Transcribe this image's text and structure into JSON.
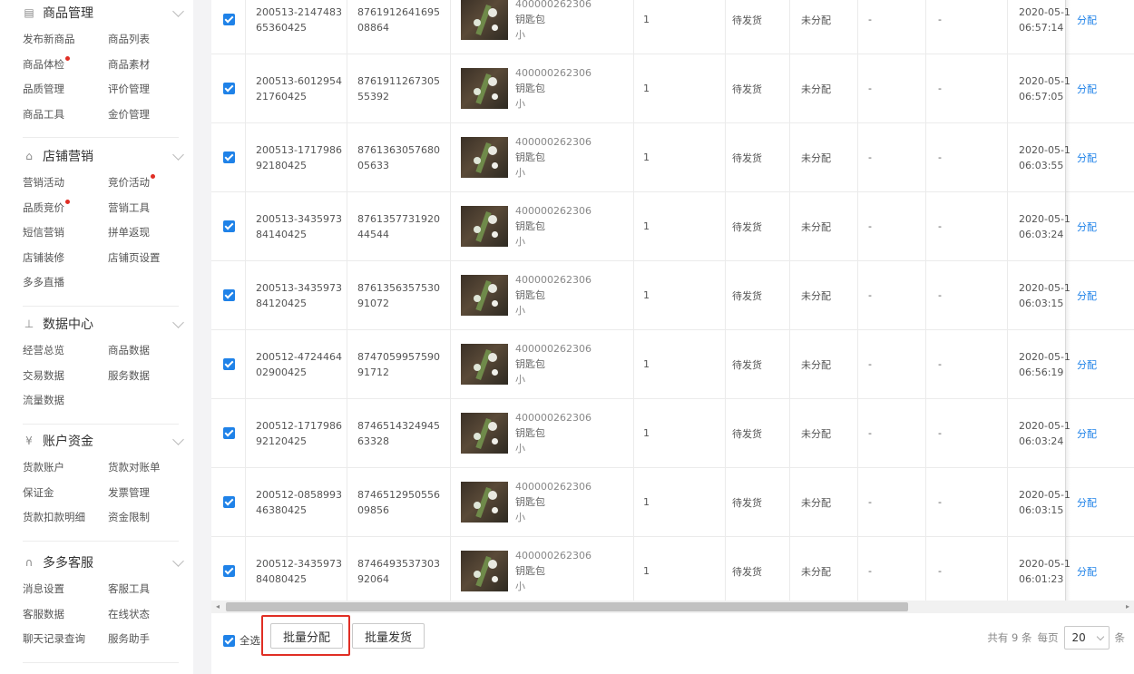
{
  "sidebar": {
    "sections": [
      {
        "title": "商品管理",
        "icon": "calendar-icon",
        "items": [
          {
            "label": "发布新商品",
            "dot": false
          },
          {
            "label": "商品列表",
            "dot": false
          },
          {
            "label": "商品体检",
            "dot": true
          },
          {
            "label": "商品素材",
            "dot": false
          },
          {
            "label": "品质管理",
            "dot": false
          },
          {
            "label": "评价管理",
            "dot": false
          },
          {
            "label": "商品工具",
            "dot": false
          },
          {
            "label": "金价管理",
            "dot": false
          }
        ]
      },
      {
        "title": "店铺营销",
        "icon": "gift-icon",
        "items": [
          {
            "label": "营销活动",
            "dot": false
          },
          {
            "label": "竞价活动",
            "dot": true
          },
          {
            "label": "品质竞价",
            "dot": true
          },
          {
            "label": "营销工具",
            "dot": false
          },
          {
            "label": "短信营销",
            "dot": false
          },
          {
            "label": "拼单返现",
            "dot": false
          },
          {
            "label": "店铺装修",
            "dot": false
          },
          {
            "label": "店铺页设置",
            "dot": false
          },
          {
            "label": "多多直播",
            "dot": false
          }
        ]
      },
      {
        "title": "数据中心",
        "icon": "bar-chart-icon",
        "items": [
          {
            "label": "经营总览",
            "dot": false
          },
          {
            "label": "商品数据",
            "dot": false
          },
          {
            "label": "交易数据",
            "dot": false
          },
          {
            "label": "服务数据",
            "dot": false
          },
          {
            "label": "流量数据",
            "dot": false
          }
        ]
      },
      {
        "title": "账户资金",
        "icon": "yen-circle-icon",
        "items": [
          {
            "label": "货款账户",
            "dot": false
          },
          {
            "label": "货款对账单",
            "dot": false
          },
          {
            "label": "保证金",
            "dot": false
          },
          {
            "label": "发票管理",
            "dot": false
          },
          {
            "label": "货款扣款明细",
            "dot": false
          },
          {
            "label": "资金限制",
            "dot": false
          }
        ]
      },
      {
        "title": "多多客服",
        "icon": "headset-icon",
        "items": [
          {
            "label": "消息设置",
            "dot": false
          },
          {
            "label": "客服工具",
            "dot": false
          },
          {
            "label": "客服数据",
            "dot": false
          },
          {
            "label": "在线状态",
            "dot": false
          },
          {
            "label": "聊天记录查询",
            "dot": false
          },
          {
            "label": "服务助手",
            "dot": false
          }
        ]
      }
    ]
  },
  "table": {
    "rows": [
      {
        "order_a": "200513-2147483",
        "order_b": "65360425",
        "track_a": "8761912641695",
        "track_b": "08864",
        "sku": "400000262306",
        "name": "钥匙包",
        "spec": "小",
        "qty": "1",
        "status": "待发货",
        "assign": "未分配",
        "c1": "-",
        "c2": "-",
        "date": "2020-05-1",
        "time": "06:57:14",
        "action": "分配"
      },
      {
        "order_a": "200513-6012954",
        "order_b": "21760425",
        "track_a": "8761911267305",
        "track_b": "55392",
        "sku": "400000262306",
        "name": "钥匙包",
        "spec": "小",
        "qty": "1",
        "status": "待发货",
        "assign": "未分配",
        "c1": "-",
        "c2": "-",
        "date": "2020-05-1",
        "time": "06:57:05",
        "action": "分配"
      },
      {
        "order_a": "200513-1717986",
        "order_b": "92180425",
        "track_a": "8761363057680",
        "track_b": "05633",
        "sku": "400000262306",
        "name": "钥匙包",
        "spec": "小",
        "qty": "1",
        "status": "待发货",
        "assign": "未分配",
        "c1": "-",
        "c2": "-",
        "date": "2020-05-1",
        "time": "06:03:55",
        "action": "分配"
      },
      {
        "order_a": "200513-3435973",
        "order_b": "84140425",
        "track_a": "8761357731920",
        "track_b": "44544",
        "sku": "400000262306",
        "name": "钥匙包",
        "spec": "小",
        "qty": "1",
        "status": "待发货",
        "assign": "未分配",
        "c1": "-",
        "c2": "-",
        "date": "2020-05-1",
        "time": "06:03:24",
        "action": "分配"
      },
      {
        "order_a": "200513-3435973",
        "order_b": "84120425",
        "track_a": "8761356357530",
        "track_b": "91072",
        "sku": "400000262306",
        "name": "钥匙包",
        "spec": "小",
        "qty": "1",
        "status": "待发货",
        "assign": "未分配",
        "c1": "-",
        "c2": "-",
        "date": "2020-05-1",
        "time": "06:03:15",
        "action": "分配"
      },
      {
        "order_a": "200512-4724464",
        "order_b": "02900425",
        "track_a": "8747059957590",
        "track_b": "91712",
        "sku": "400000262306",
        "name": "钥匙包",
        "spec": "小",
        "qty": "1",
        "status": "待发货",
        "assign": "未分配",
        "c1": "-",
        "c2": "-",
        "date": "2020-05-1",
        "time": "06:56:19",
        "action": "分配"
      },
      {
        "order_a": "200512-1717986",
        "order_b": "92120425",
        "track_a": "8746514324945",
        "track_b": "63328",
        "sku": "400000262306",
        "name": "钥匙包",
        "spec": "小",
        "qty": "1",
        "status": "待发货",
        "assign": "未分配",
        "c1": "-",
        "c2": "-",
        "date": "2020-05-1",
        "time": "06:03:24",
        "action": "分配"
      },
      {
        "order_a": "200512-0858993",
        "order_b": "46380425",
        "track_a": "8746512950556",
        "track_b": "09856",
        "sku": "400000262306",
        "name": "钥匙包",
        "spec": "小",
        "qty": "1",
        "status": "待发货",
        "assign": "未分配",
        "c1": "-",
        "c2": "-",
        "date": "2020-05-1",
        "time": "06:03:15",
        "action": "分配"
      },
      {
        "order_a": "200512-3435973",
        "order_b": "84080425",
        "track_a": "8746493537303",
        "track_b": "92064",
        "sku": "400000262306",
        "name": "钥匙包",
        "spec": "小",
        "qty": "1",
        "status": "待发货",
        "assign": "未分配",
        "c1": "-",
        "c2": "-",
        "date": "2020-05-1",
        "time": "06:01:23",
        "action": "分配"
      }
    ]
  },
  "footer": {
    "select_all": "全选",
    "batch_assign": "批量分配",
    "batch_ship": "批量发货",
    "total": "共有 9 条",
    "per_page_label": "每页",
    "per_page_value": "20",
    "unit": "条"
  },
  "colors": {
    "accent": "#1f82e8",
    "highlight": "#e02e24"
  }
}
